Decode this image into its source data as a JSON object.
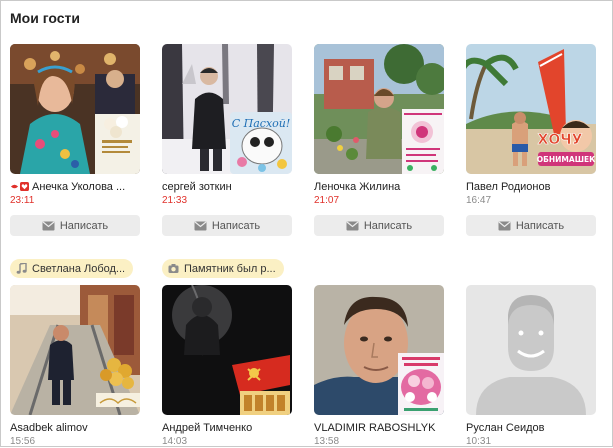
{
  "section_title": "Мои гости",
  "write_label": "Написать",
  "colors": {
    "accent_time": "#e0312b",
    "muted_time": "#8a8a8a",
    "tag_bg": "#fbf0c4",
    "button_bg": "#ececec"
  },
  "guests_row1": [
    {
      "name": "Анечка Уколова ...",
      "time": "23:11",
      "badges": [
        "lips-icon",
        "heart-icon"
      ]
    },
    {
      "name": "сергей зоткин",
      "time": "21:33"
    },
    {
      "name": "Леночка Жилина",
      "time": "21:07"
    },
    {
      "name": "Павел Родионов",
      "time": "16:47"
    }
  ],
  "stickers": {
    "easter": "С Пасхой!",
    "hochu": "ХОЧУ",
    "obnimashek": "ОБНИМАШЕК"
  },
  "tags": [
    {
      "icon": "music-note-icon",
      "text": "Светлана Лобод..."
    },
    {
      "icon": "camera-icon",
      "text": "Памятник был р..."
    }
  ],
  "guests_row2": [
    {
      "name": "Asadbek alimov",
      "time": "15:56"
    },
    {
      "name": "Андрей Тимченко",
      "time": "14:03"
    },
    {
      "name": "VLADIMIR RABOSHLYK",
      "time": "13:58"
    },
    {
      "name": "Руслан Сеидов",
      "time": "10:31"
    }
  ]
}
